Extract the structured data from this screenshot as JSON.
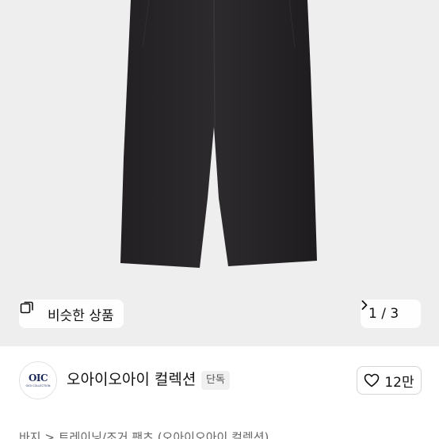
{
  "product_image": {
    "similar_products_label": "비슷한 상품",
    "pager": "1 / 3"
  },
  "brand": {
    "logo_text": "OIC",
    "logo_subtext": "OIOI COLLECTION",
    "name": "오아이오아이 컬렉션",
    "exclusive_badge": "단독",
    "like_count": "12만"
  },
  "breadcrumb": "바지 > 트레이닝/조거 팬츠 (오아이오아이 컬렉션)"
}
